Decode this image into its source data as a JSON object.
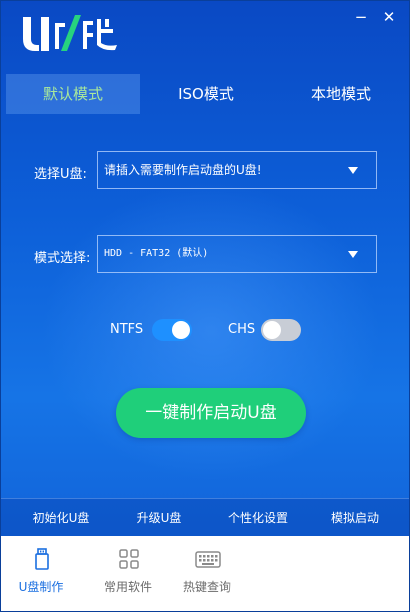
{
  "app": {
    "logo_text": "U极速",
    "minimize_label": "−",
    "close_label": "✕"
  },
  "tabs": [
    {
      "label": "默认模式",
      "active": true
    },
    {
      "label": "ISO模式",
      "active": false
    },
    {
      "label": "本地模式",
      "active": false
    }
  ],
  "form": {
    "usb_label": "选择U盘:",
    "usb_value": "请插入需要制作启动盘的U盘!",
    "mode_label": "模式选择:",
    "mode_value": "HDD - FAT32 (默认)"
  },
  "toggles": {
    "ntfs": {
      "label": "NTFS",
      "on": true
    },
    "chs": {
      "label": "CHS",
      "on": false
    }
  },
  "main_button": "一键制作启动U盘",
  "functions": [
    "初始化U盘",
    "升级U盘",
    "个性化设置",
    "模拟启动"
  ],
  "footer_nav": [
    {
      "label": "U盘制作",
      "icon": "usb-icon",
      "active": true
    },
    {
      "label": "常用软件",
      "icon": "apps-grid-icon",
      "active": false
    },
    {
      "label": "热键查询",
      "icon": "keyboard-icon",
      "active": false
    }
  ],
  "colors": {
    "accent_green": "#1fcf7a",
    "toggle_on": "#1e90ff",
    "active_tab_text": "#a8e89c",
    "nav_active": "#1b6fe0"
  }
}
